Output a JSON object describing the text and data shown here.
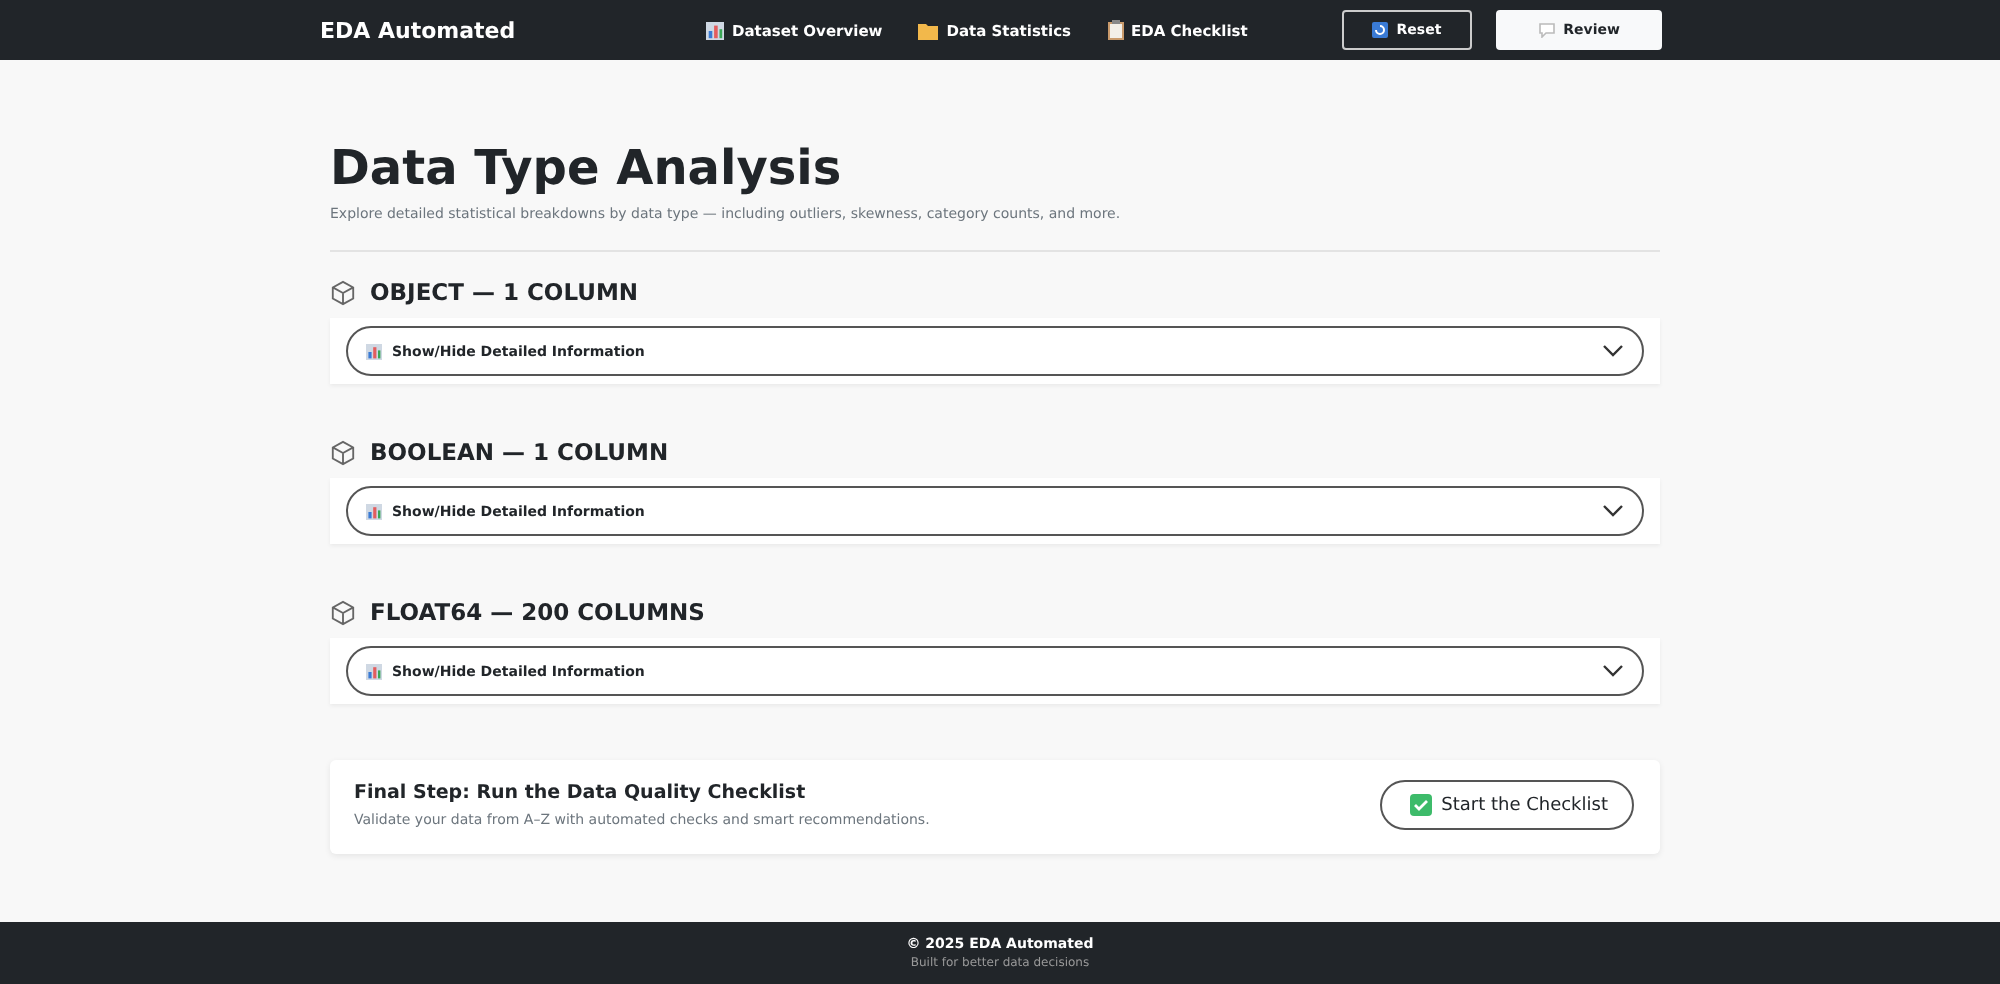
{
  "navbar": {
    "brand": "EDA Automated",
    "links": [
      {
        "kind": "chart",
        "label": "Dataset Overview"
      },
      {
        "kind": "folder",
        "label": "Data Statistics"
      },
      {
        "kind": "clipboard",
        "label": "EDA Checklist"
      }
    ],
    "buttons": [
      {
        "kind": "outline",
        "label": "Reset"
      },
      {
        "kind": "solid",
        "label": "Review"
      }
    ]
  },
  "page": {
    "title": "Data Type Analysis",
    "subtitle": "Explore detailed statistical breakdowns by data type — including outliers, skewness, category counts, and more."
  },
  "sections": [
    {
      "heading": "OBJECT — 1 COLUMN",
      "toggle": "Show/Hide Detailed Information",
      "expanded": false
    },
    {
      "heading": "BOOLEAN — 1 COLUMN",
      "toggle": "Show/Hide Detailed Information",
      "expanded": false
    },
    {
      "heading": "FLOAT64 — 200 COLUMNS",
      "toggle": "Show/Hide Detailed Information",
      "expanded": false
    }
  ],
  "final_step": {
    "title": "Final Step: Run the Data Quality Checklist",
    "text": "Validate your data from A–Z with automated checks and smart recommendations.",
    "button": "Start the Checklist"
  },
  "footer": {
    "copyright": "© 2025 EDA Automated",
    "tagline": "Built for better data decisions"
  }
}
